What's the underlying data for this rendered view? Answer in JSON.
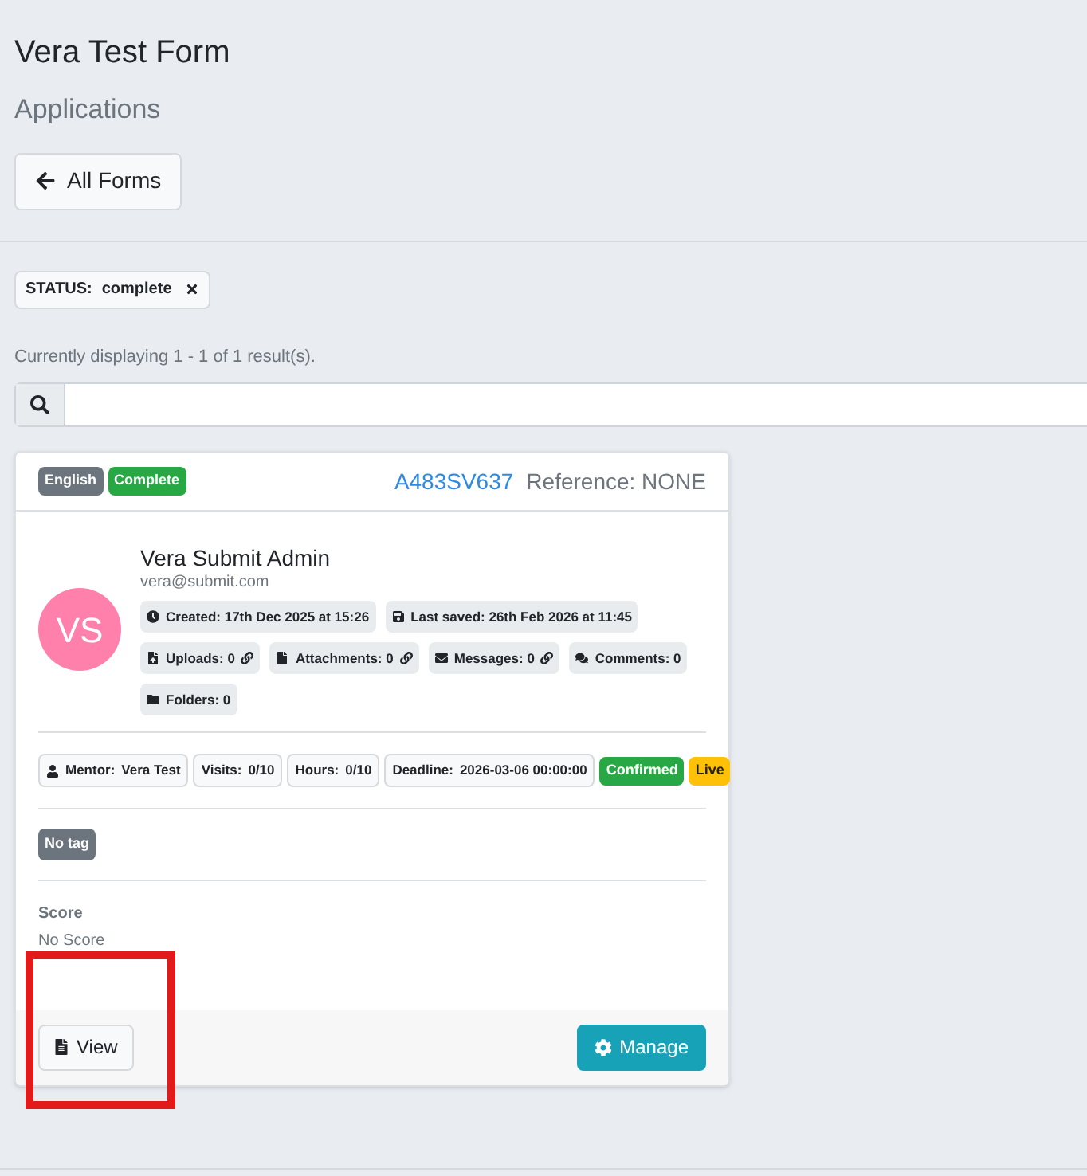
{
  "page": {
    "title": "Vera Test Form",
    "subtitle": "Applications"
  },
  "back_button": {
    "label": "All Forms"
  },
  "filters": [
    {
      "label": "STATUS:",
      "value": "complete"
    }
  ],
  "results_text": "Currently displaying 1 - 1 of 1 result(s).",
  "card": {
    "badges": [
      {
        "label": "English",
        "color": "#6c757d"
      },
      {
        "label": "Complete",
        "color": "#28a745"
      }
    ],
    "id": "A483SV637",
    "reference": "Reference: NONE",
    "avatar": {
      "initials": "VS"
    },
    "name": "Vera Submit Admin",
    "email": "vera@submit.com",
    "meta": [
      {
        "kind": "clock",
        "label": "Created: 17th Dec 2025 at 15:26",
        "link": false
      },
      {
        "kind": "save",
        "label": "Last saved: 26th Feb 2026 at 11:45",
        "link": false
      },
      {
        "kind": "upload",
        "label": "Uploads: 0",
        "link": true
      },
      {
        "kind": "file",
        "label": "Attachments: 0",
        "link": true
      },
      {
        "kind": "envelope",
        "label": "Messages: 0",
        "link": true
      },
      {
        "kind": "comments",
        "label": "Comments: 0",
        "link": false
      },
      {
        "kind": "folder",
        "label": "Folders: 0",
        "link": false
      }
    ],
    "details": [
      {
        "kind": "user",
        "label": "Mentor:",
        "value": "Vera Test"
      },
      {
        "kind": "plain",
        "label": "Visits:",
        "value": "0/10"
      },
      {
        "kind": "plain",
        "label": "Hours:",
        "value": "0/10"
      },
      {
        "kind": "plain",
        "label": "Deadline:",
        "value": "2026-03-06 00:00:00"
      }
    ],
    "statuses": [
      {
        "label": "Confirmed",
        "color": "#28a745"
      },
      {
        "label": "Live",
        "color": "#ffc107"
      }
    ],
    "tags": [
      {
        "label": "No tag"
      }
    ],
    "score": {
      "label": "Score",
      "value": "No Score"
    },
    "buttons": [
      {
        "kind": "view",
        "label": "View"
      },
      {
        "kind": "manage",
        "label": "Manage"
      }
    ]
  }
}
